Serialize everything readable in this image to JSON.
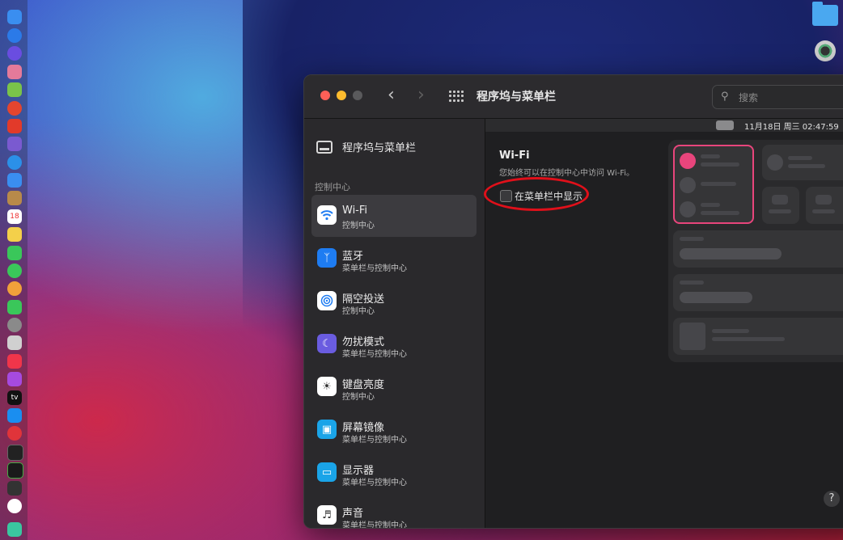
{
  "window": {
    "title": "程序坞与菜单栏",
    "search_placeholder": "搜索",
    "menubar_preview": {
      "date_time": "11月18日 周三 02:47:59"
    }
  },
  "sidebar": {
    "top_item": "程序坞与菜单栏",
    "section_header": "控制中心",
    "items": [
      {
        "label": "Wi-Fi",
        "sub": "控制中心",
        "icon": "wifi-icon",
        "color": "#ffffff"
      },
      {
        "label": "蓝牙",
        "sub": "菜单栏与控制中心",
        "icon": "bluetooth-icon",
        "color": "#1e7cf2"
      },
      {
        "label": "隔空投送",
        "sub": "控制中心",
        "icon": "airdrop-icon",
        "color": "#ffffff"
      },
      {
        "label": "勿扰模式",
        "sub": "菜单栏与控制中心",
        "icon": "moon-icon",
        "color": "#6a5ce0"
      },
      {
        "label": "键盘亮度",
        "sub": "控制中心",
        "icon": "keyboard-brightness-icon",
        "color": "#ffffff"
      },
      {
        "label": "屏幕镜像",
        "sub": "菜单栏与控制中心",
        "icon": "screen-mirroring-icon",
        "color": "#1aa4e8"
      },
      {
        "label": "显示器",
        "sub": "菜单栏与控制中心",
        "icon": "display-icon",
        "color": "#1aa4e8"
      },
      {
        "label": "声音",
        "sub": "菜单栏与控制中心",
        "icon": "speaker-icon",
        "color": "#ffffff"
      }
    ]
  },
  "detail": {
    "title": "Wi-Fi",
    "description": "您始终可以在控制中心中访问 Wi-Fi。",
    "checkbox_label": "在菜单栏中显示",
    "checkbox_checked": false
  },
  "colors": {
    "accent_pink": "#e8457c",
    "highlight_ring": "#e0101a"
  }
}
